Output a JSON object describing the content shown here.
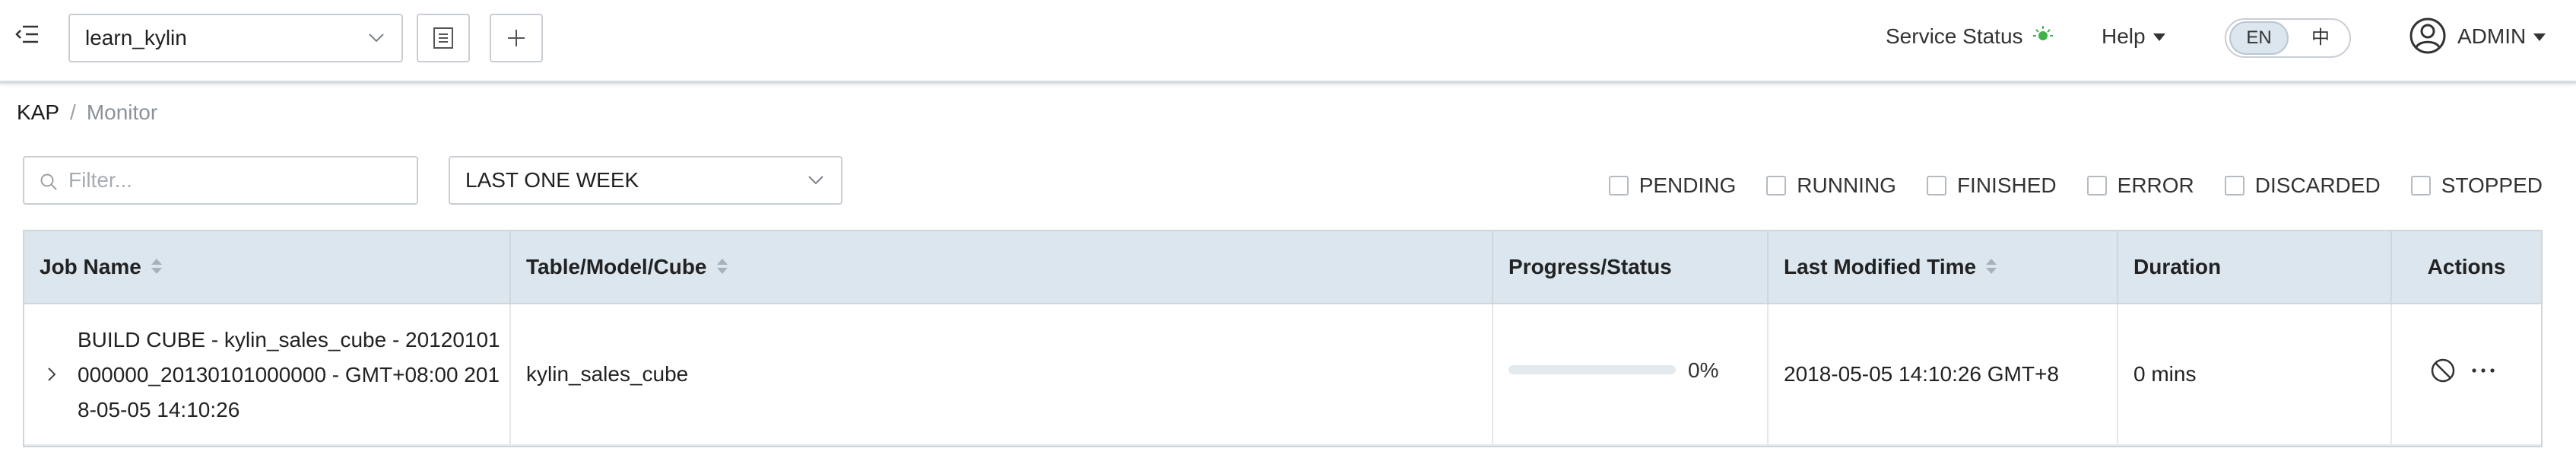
{
  "header": {
    "menu_icon": "menu-fold-icon",
    "project": "learn_kylin",
    "list_button_icon": "list-icon",
    "add_button_icon": "plus-icon",
    "service_status_label": "Service Status",
    "service_status_color": "#3fb24a",
    "help_label": "Help",
    "lang_en": "EN",
    "lang_zh": "中",
    "lang_selected": "EN",
    "user_name": "ADMIN"
  },
  "breadcrumb": {
    "root": "KAP",
    "separator": "/",
    "current": "Monitor"
  },
  "filters": {
    "search_placeholder": "Filter...",
    "search_value": "",
    "time_range": "LAST ONE WEEK",
    "statuses": [
      {
        "label": "PENDING",
        "checked": false
      },
      {
        "label": "RUNNING",
        "checked": false
      },
      {
        "label": "FINISHED",
        "checked": false
      },
      {
        "label": "ERROR",
        "checked": false
      },
      {
        "label": "DISCARDED",
        "checked": false
      },
      {
        "label": "STOPPED",
        "checked": false
      }
    ]
  },
  "table": {
    "columns": {
      "job_name": "Job Name",
      "target": "Table/Model/Cube",
      "progress": "Progress/Status",
      "modified": "Last Modified Time",
      "duration": "Duration",
      "actions": "Actions"
    },
    "rows": [
      {
        "job_name": "BUILD CUBE - kylin_sales_cube - 20120101000000_20130101000000 - GMT+08:00 2018-05-05 14:10:26",
        "target": "kylin_sales_cube",
        "progress": 0,
        "progress_label": "0%",
        "modified": "2018-05-05 14:10:26 GMT+8",
        "duration": "0 mins"
      }
    ]
  },
  "colors": {
    "header_bg": "#dbe6ee",
    "progress_track": "#e4e9ee",
    "progress_fill": "#3a8ee6"
  }
}
